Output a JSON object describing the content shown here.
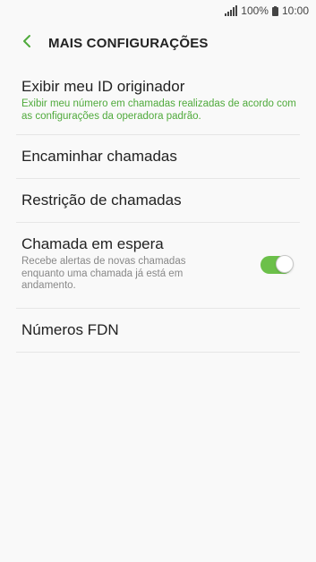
{
  "status_bar": {
    "battery": "100%",
    "time": "10:00"
  },
  "header": {
    "title": "MAIS CONFIGURAÇÕES",
    "back_icon": "chevron-left-icon"
  },
  "items": [
    {
      "title": "Exibir meu ID originador",
      "subtitle": "Exibir meu número em chamadas realizadas de acordo com as configurações da operadora padrão."
    },
    {
      "title": "Encaminhar chamadas"
    },
    {
      "title": "Restrição de chamadas"
    },
    {
      "title": "Chamada em espera",
      "subtitle": "Recebe alertas de novas chamadas enquanto uma chamada já está em andamento.",
      "toggle_on": true
    },
    {
      "title": "Números FDN"
    }
  ],
  "colors": {
    "accent": "#4faa3b",
    "toggle_on": "#6cc04a",
    "background": "#f9f9f9",
    "divider": "#e6e6e6"
  }
}
